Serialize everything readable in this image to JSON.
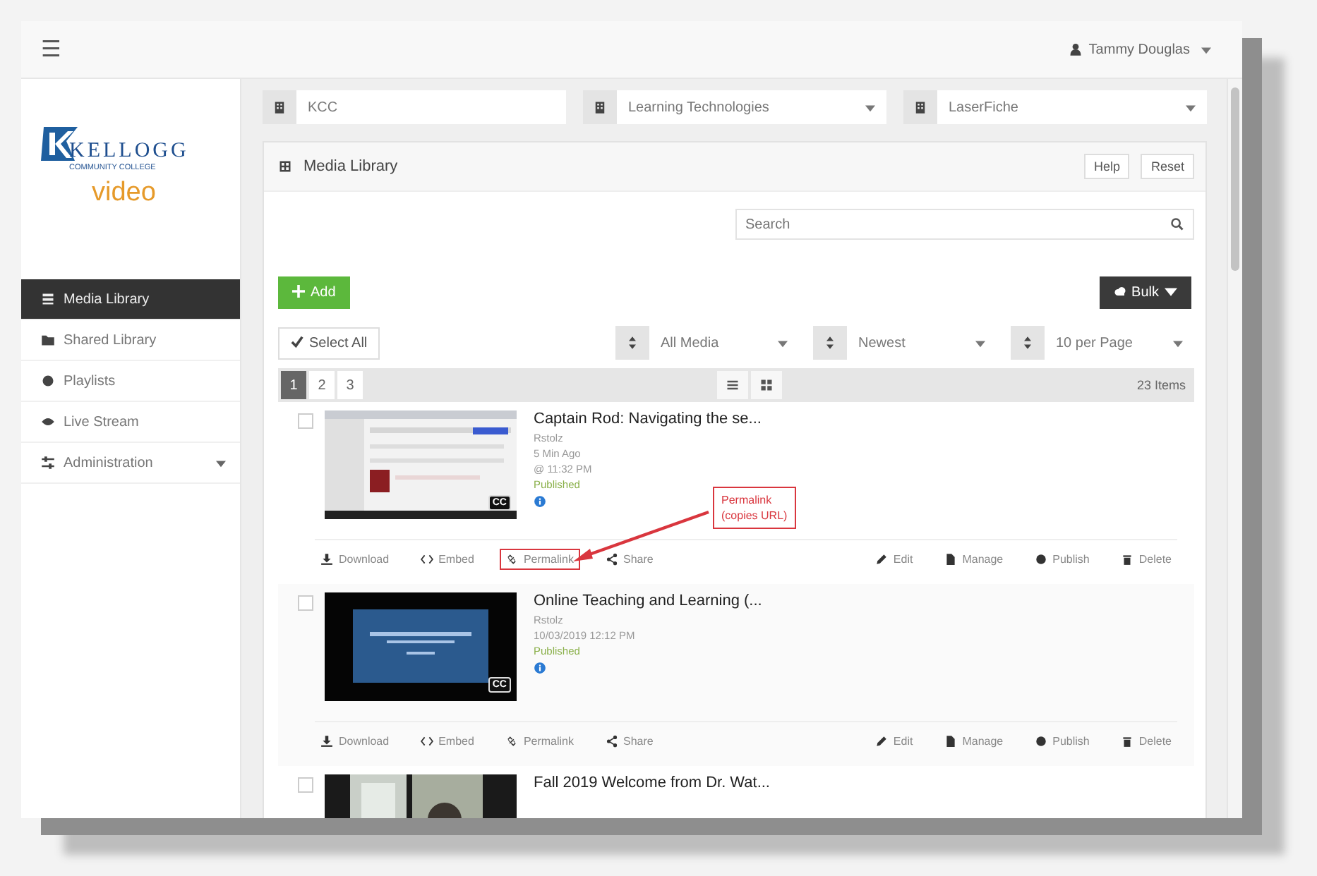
{
  "topbar": {
    "menu": "☰",
    "user": "Tammy Douglas"
  },
  "logo": {
    "name": "KELLOGG",
    "sub": "COMMUNITY COLLEGE",
    "product": "video"
  },
  "sidebar": {
    "items": [
      {
        "label": "Media Library",
        "selected": true,
        "submenu": false
      },
      {
        "label": "Shared Library",
        "selected": false,
        "submenu": false
      },
      {
        "label": "Playlists",
        "selected": false,
        "submenu": false
      },
      {
        "label": "Live Stream",
        "selected": false,
        "submenu": false
      },
      {
        "label": "Administration",
        "selected": false,
        "submenu": true
      }
    ]
  },
  "filters": [
    {
      "value": "KCC",
      "dropdown": false
    },
    {
      "value": "Learning Technologies",
      "dropdown": true
    },
    {
      "value": "LaserFiche",
      "dropdown": true
    }
  ],
  "panel": {
    "title": "Media Library",
    "header_buttons": [
      "Help",
      "Reset"
    ],
    "search": {
      "placeholder": "Search"
    },
    "add_button": "Add",
    "bulk_button": "Bulk",
    "select_all": "Select All",
    "sorts": [
      "All Media",
      "Newest",
      "10 per Page"
    ],
    "pages": [
      {
        "label": "1",
        "selected": true
      },
      {
        "label": "2",
        "selected": false
      },
      {
        "label": "3",
        "selected": false
      }
    ],
    "count": "23 Items",
    "items": [
      {
        "title": "Captain Rod: Navigating the se...",
        "checked": false,
        "cc": "CC",
        "meta": [
          "Rstolz",
          "5 Min Ago",
          "@ 11:32 PM"
        ],
        "status": "Published",
        "left_actions": [
          {
            "label": "Download",
            "highlighted": false
          },
          {
            "label": "Embed",
            "highlighted": false
          },
          {
            "label": "Permalink",
            "highlighted": true
          },
          {
            "label": "Share",
            "highlighted": false
          }
        ],
        "right_actions": [
          "Edit",
          "Manage",
          "Publish",
          "Delete"
        ],
        "callout": [
          "Permalink",
          "(copies URL)"
        ]
      },
      {
        "title": "Online Teaching and Learning (...",
        "checked": false,
        "cc": "CC",
        "meta": [
          "Rstolz",
          "10/03/2019 12:12 PM"
        ],
        "status": "Published",
        "left_actions": [
          {
            "label": "Download",
            "highlighted": false
          },
          {
            "label": "Embed",
            "highlighted": false
          },
          {
            "label": "Permalink",
            "highlighted": false
          },
          {
            "label": "Share",
            "highlighted": false
          }
        ],
        "right_actions": [
          "Edit",
          "Manage",
          "Publish",
          "Delete"
        ]
      },
      {
        "title": "Fall 2019 Welcome from Dr. Wat...",
        "checked": false
      }
    ]
  }
}
